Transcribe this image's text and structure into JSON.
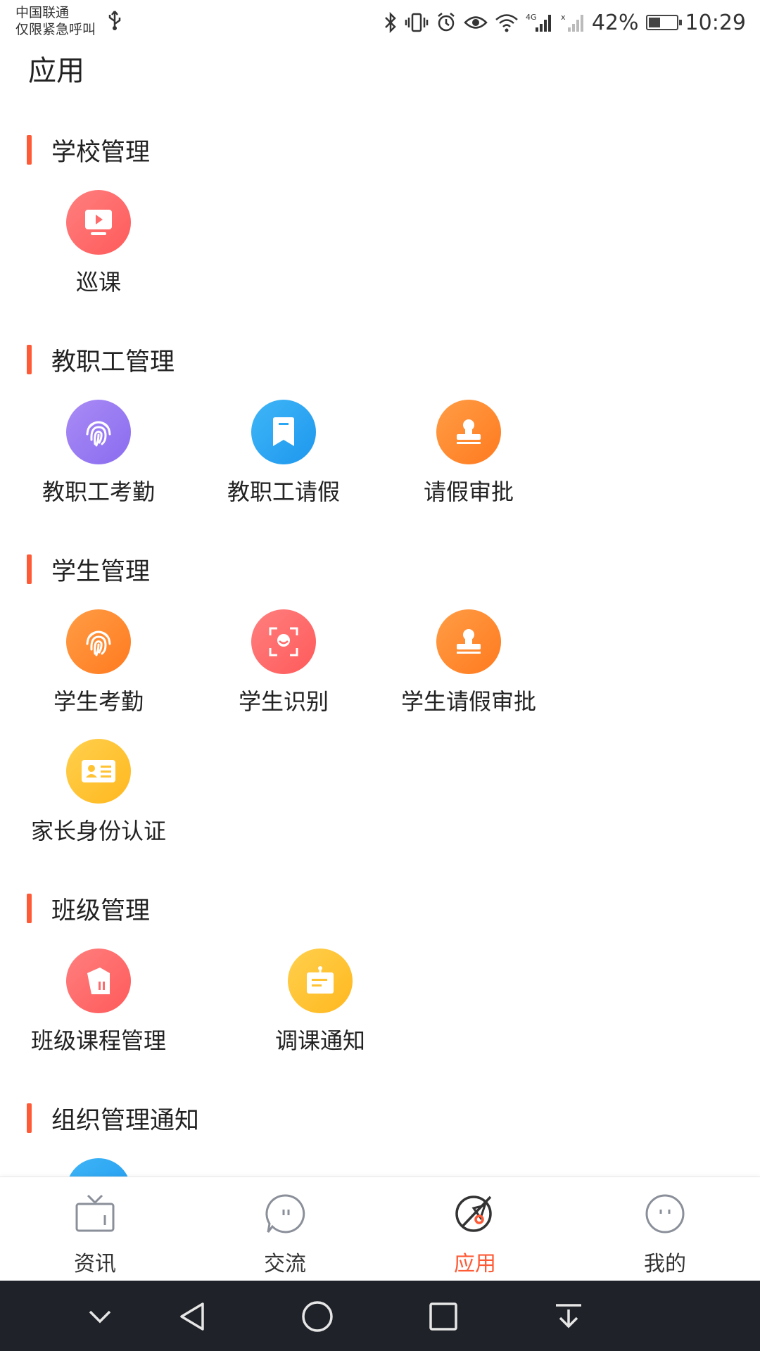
{
  "status_bar": {
    "carrier_line1": "中国联通",
    "carrier_line2": "仅限紧急呼叫",
    "battery_percent": "42%",
    "battery_level": 0.42,
    "time": "10:29",
    "icons": [
      "usb-icon",
      "bluetooth-icon",
      "vibrate-icon",
      "alarm-icon",
      "eye-icon",
      "wifi-icon",
      "signal-4g-icon",
      "signal-no-sim-icon",
      "battery-charging-icon"
    ]
  },
  "page": {
    "title": "应用"
  },
  "sections": [
    {
      "title": "学校管理",
      "apps": [
        {
          "label": "巡课",
          "icon": "video-play-icon",
          "color": "#ff6b6b"
        }
      ]
    },
    {
      "title": "教职工管理",
      "apps": [
        {
          "label": "教职工考勤",
          "icon": "fingerprint-icon",
          "color": "#9b7bf0"
        },
        {
          "label": "教职工请假",
          "icon": "bookmark-icon",
          "color": "#2aa7f4"
        },
        {
          "label": "请假审批",
          "icon": "stamp-icon",
          "color": "#ff8a2b"
        }
      ]
    },
    {
      "title": "学生管理",
      "apps": [
        {
          "label": "学生考勤",
          "icon": "fingerprint-icon",
          "color": "#ff8a2b"
        },
        {
          "label": "学生识别",
          "icon": "face-scan-icon",
          "color": "#ff6b6b"
        },
        {
          "label": "学生请假审批",
          "icon": "stamp-icon",
          "color": "#ff8a2b"
        },
        {
          "label": "家长身份认证",
          "icon": "id-card-icon",
          "color": "#ffc233"
        }
      ]
    },
    {
      "title": "班级管理",
      "apps": [
        {
          "label": "班级课程管理",
          "icon": "course-book-icon",
          "color": "#ff6b6b"
        },
        {
          "label": "调课通知",
          "icon": "notice-board-icon",
          "color": "#ffc233"
        }
      ]
    },
    {
      "title": "组织管理通知",
      "apps": [
        {
          "label": "",
          "icon": "info-icon",
          "color": "#2aa7f4"
        }
      ]
    }
  ],
  "bottom_nav": {
    "items": [
      {
        "label": "资讯",
        "icon": "tv-news-icon"
      },
      {
        "label": "交流",
        "icon": "chat-bubble-icon"
      },
      {
        "label": "应用",
        "icon": "apps-compass-icon",
        "active": true
      },
      {
        "label": "我的",
        "icon": "smiley-face-icon"
      }
    ],
    "active_color": "#ff5a36"
  },
  "system_nav": {
    "icons": [
      "chevron-down-icon",
      "back-triangle-icon",
      "home-circle-icon",
      "recents-square-icon",
      "pull-down-icon"
    ]
  }
}
